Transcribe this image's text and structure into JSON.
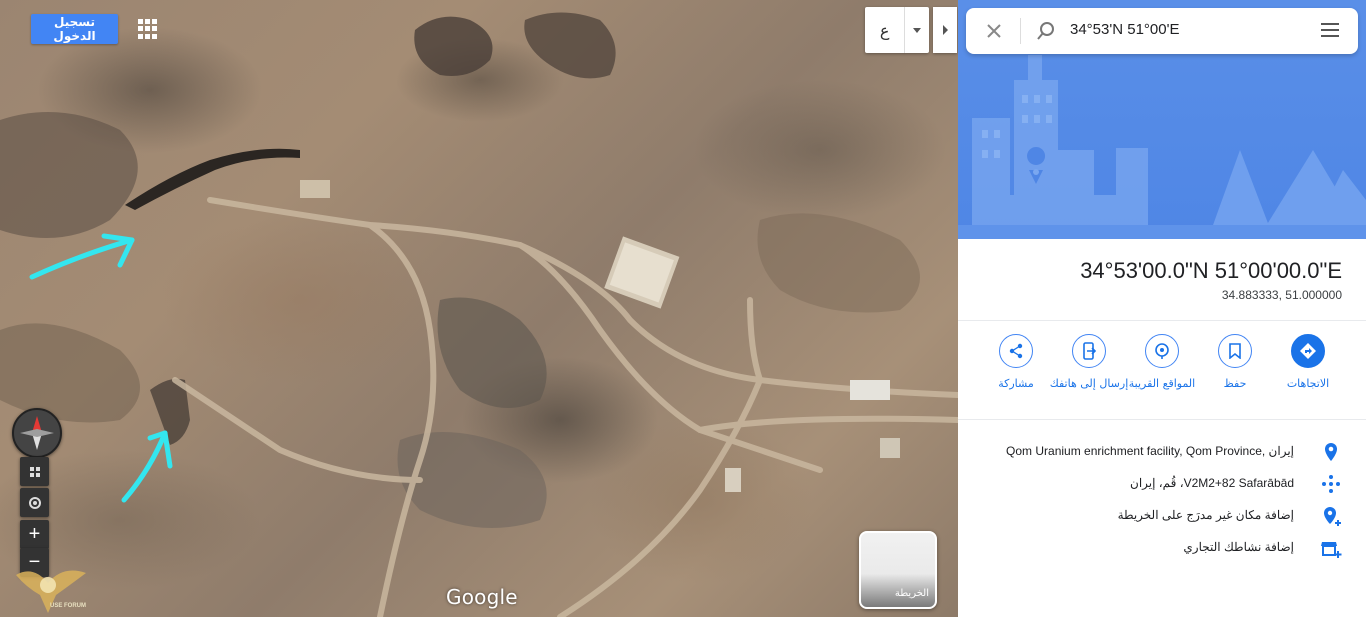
{
  "map": {
    "signin_label": "تسجيل الدخول",
    "lang_char": "ع",
    "google_logo": "Google",
    "layer_label": "الخريطة",
    "watermark_text": "USE FORUM"
  },
  "search": {
    "value": "34°53'N 51°00'E"
  },
  "place": {
    "coords_dms": "34°53'00.0\"N 51°00'00.0\"E",
    "coords_decimal": "34.883333, 51.000000"
  },
  "actions": [
    {
      "label": "الاتجاهات",
      "icon": "directions-icon"
    },
    {
      "label": "حفظ",
      "icon": "bookmark-icon"
    },
    {
      "label": "المواقع القريبة",
      "icon": "nearby-icon"
    },
    {
      "label": "إرسال إلى هاتفك",
      "icon": "send-to-phone-icon"
    },
    {
      "label": "مشاركة",
      "icon": "share-icon"
    }
  ],
  "info": {
    "address": "إيران ,Qom Uranium enrichment facility, Qom Province",
    "plus_code": "V2M2+82 Safarābād، قُم، إيران",
    "add_place": "إضافة مكان غير مدرَج على الخريطة",
    "add_business": "إضافة نشاطك التجاري"
  },
  "colors": {
    "accent": "#1a73e8",
    "hero": "#4f86e5",
    "arrow_annotation": "#33e6ef"
  }
}
